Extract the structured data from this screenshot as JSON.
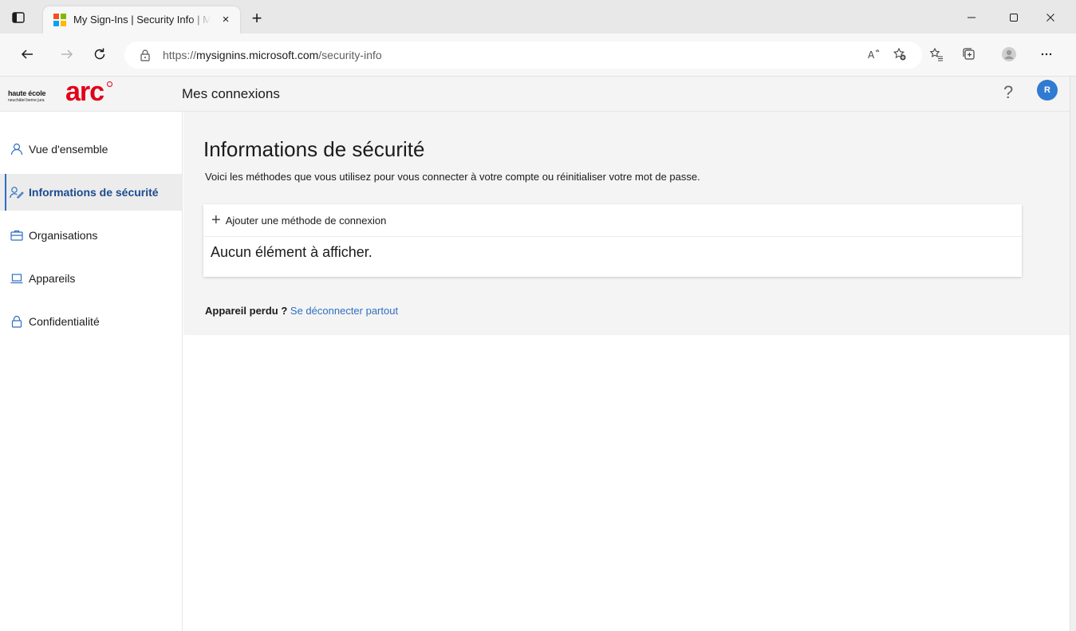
{
  "browser": {
    "tab_title": "My Sign-Ins | Security Info | Microsoft",
    "tab_close": "×",
    "new_tab": "+",
    "url_prefix": "https://",
    "url_host": "mysignins.microsoft.com",
    "url_path": "/security-info",
    "favicon_colors": [
      "#f25022",
      "#7fba00",
      "#00a4ef",
      "#ffb900"
    ]
  },
  "header": {
    "logo_text": "haute école",
    "logo_subtext": "neuchâtel berne jura",
    "logo_brand": "arc",
    "app_title": "Mes connexions",
    "help": "?",
    "avatar_initial": "R"
  },
  "sidebar": {
    "items": [
      {
        "label": "Vue d'ensemble",
        "icon": "person-icon"
      },
      {
        "label": "Informations de sécurité",
        "icon": "security-info-icon",
        "active": true
      },
      {
        "label": "Organisations",
        "icon": "briefcase-icon"
      },
      {
        "label": "Appareils",
        "icon": "laptop-icon"
      },
      {
        "label": "Confidentialité",
        "icon": "lock-icon"
      }
    ]
  },
  "main": {
    "title": "Informations de sécurité",
    "description": "Voici les méthodes que vous utilisez pour vous connecter à votre compte ou réinitialiser votre mot de passe.",
    "add_method": "Ajouter une méthode de connexion",
    "empty_text": "Aucun élément à afficher.",
    "lost_label": "Appareil perdu ?",
    "lost_link": "Se déconnecter partout"
  },
  "colors": {
    "accent": "#2f6fc1",
    "brand_red": "#e2001a"
  }
}
